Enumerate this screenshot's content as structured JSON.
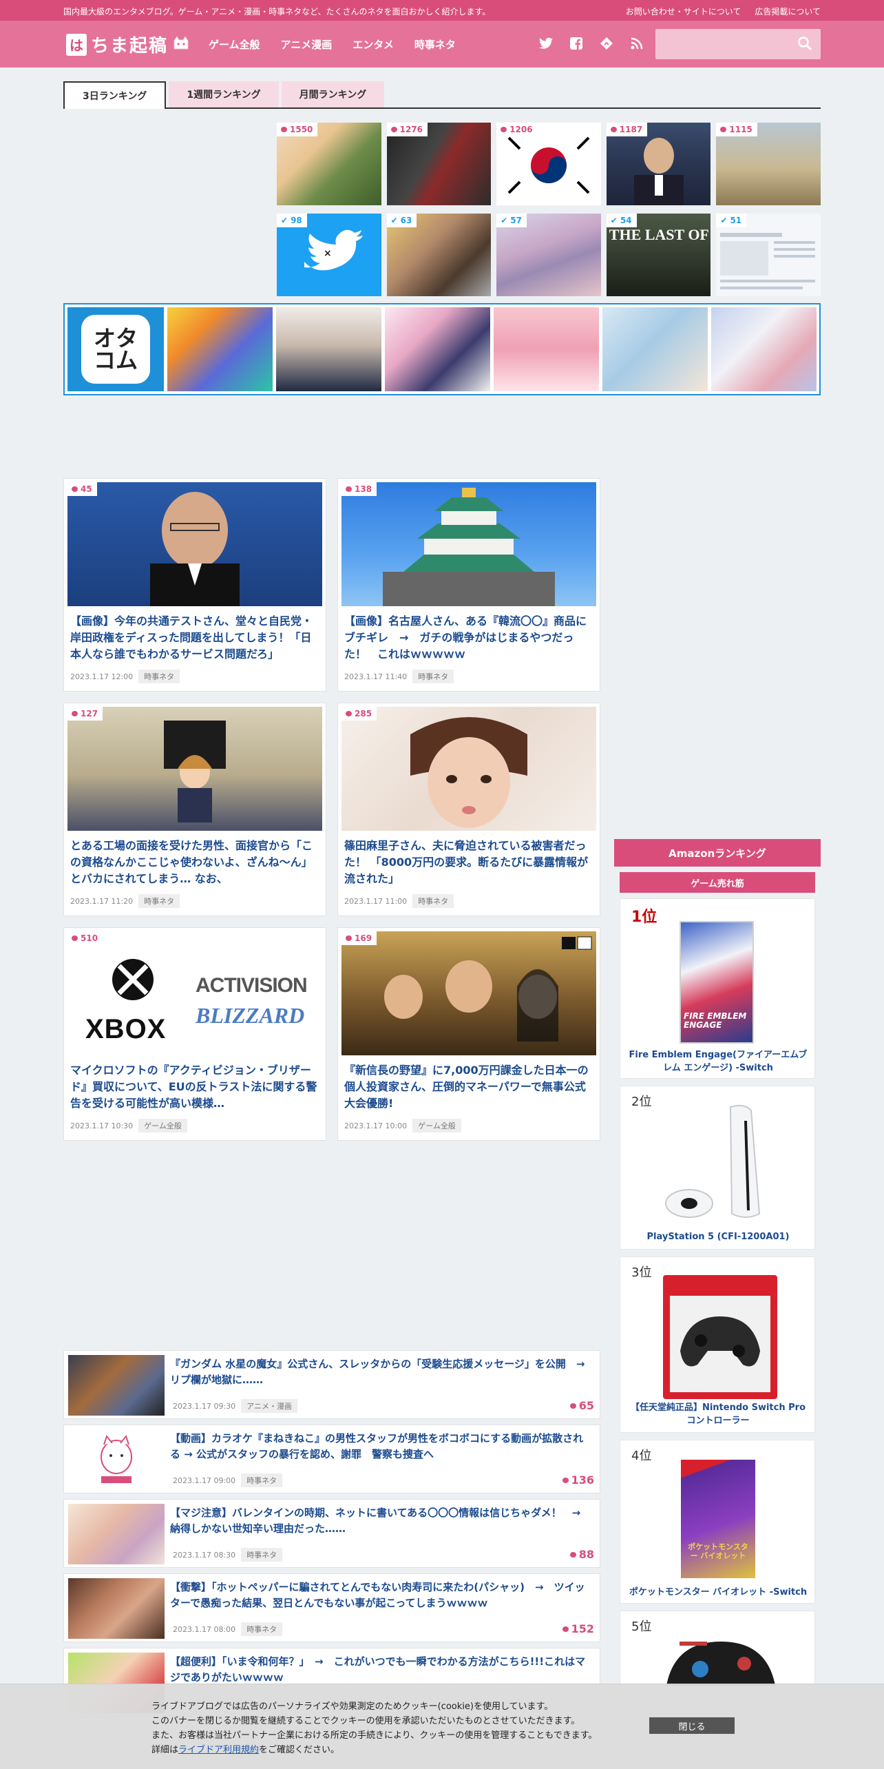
{
  "topbar": {
    "tagline": "国内最大級のエンタメブログ。ゲーム・アニメ・漫画・時事ネタなど、たくさんのネタを面白おかしく紹介します。",
    "links": [
      "お問い合わせ・サイトについて",
      "広告掲載について"
    ]
  },
  "header": {
    "logo_mark": "は",
    "logo_text": "ちま起稿",
    "nav": [
      "ゲーム全般",
      "アニメ漫画",
      "エンタメ",
      "時事ネタ"
    ],
    "social_icons": [
      "twitter-icon",
      "facebook-icon",
      "feedly-icon",
      "rss-icon"
    ],
    "search_placeholder": ""
  },
  "ranking": {
    "tabs": [
      "3日ランキング",
      "1週間ランキング",
      "月間ランキング"
    ],
    "active_tab": "3日ランキング",
    "row1_counts": [
      "1550",
      "1276",
      "1206",
      "1187",
      "1115"
    ],
    "row2_counts": [
      "98",
      "63",
      "57",
      "54",
      "51"
    ],
    "row2_overlay_text": [
      "",
      "",
      "",
      "THE LAST OF U",
      ""
    ]
  },
  "banner": {
    "logo_line1": "オタ",
    "logo_line2": "コム"
  },
  "cards": [
    {
      "count": "45",
      "title": "【画像】今年の共通テストさん、堂々と自民党・岸田政権をディスった問題を出してしまう！「日本人なら誰でもわかるサービス問題だろ」",
      "date": "2023.1.17 12:00",
      "category": "時事ネタ"
    },
    {
      "count": "138",
      "title": "【画像】名古屋人さん、ある『韓流〇〇』商品にブチギレ　→　ガチの戦争がはじまるやつだった！　これはｗｗｗｗｗ",
      "date": "2023.1.17 11:40",
      "category": "時事ネタ"
    },
    {
      "count": "127",
      "title": "とある工場の面接を受けた男性、面接官から「この資格なんかここじゃ使わないよ、ざんね～ん」とバカにされてしまう… なお、",
      "date": "2023.1.17 11:20",
      "category": "時事ネタ"
    },
    {
      "count": "285",
      "title": "篠田麻里子さん、夫に脅迫されている被害者だった！ 「8000万円の要求。断るたびに暴露情報が流された」",
      "date": "2023.1.17 11:00",
      "category": "時事ネタ"
    },
    {
      "count": "510",
      "title": "マイクロソフトの『アクティビジョン・ブリザード』買収について、EUの反トラスト法に関する警告を受ける可能性が高い模様…",
      "date": "2023.1.17 10:30",
      "category": "ゲーム全般",
      "image_text_1": "XBOX",
      "image_text_2": "ACTIVISION",
      "image_text_3": "BLIZZARD"
    },
    {
      "count": "169",
      "title": "『新信長の野望』に7,000万円課金した日本一の個人投資家さん、圧倒的マネーパワーで無事公式大会優勝!",
      "date": "2023.1.17 10:00",
      "category": "ゲーム全般"
    }
  ],
  "list": [
    {
      "title": "『ガンダム 水星の魔女』公式さん、スレッタからの「受験生応援メッセージ」を公開　→　リプ欄が地獄に……",
      "date": "2023.1.17 09:30",
      "category": "アニメ・漫画",
      "count": "65"
    },
    {
      "title": "【動画】カラオケ『まねきねこ』の男性スタッフが男性をボコボコにする動画が拡散される → 公式がスタッフの暴行を認め、謝罪　警察も捜査へ",
      "date": "2023.1.17 09:00",
      "category": "時事ネタ",
      "count": "136"
    },
    {
      "title": "【マジ注意】バレンタインの時期、ネットに書いてある〇〇〇情報は信じちゃダメ！　→　納得しかない世知辛い理由だった……",
      "date": "2023.1.17 08:30",
      "category": "時事ネタ",
      "count": "88"
    },
    {
      "title": "【衝撃】「ホットペッパーに騙されてとんでもない肉寿司に来たわ(パシャッ)　→　ツイッターで愚痴った結果、翌日とんでもない事が起こってしまうｗｗｗｗ",
      "date": "2023.1.17 08:00",
      "category": "時事ネタ",
      "count": "152"
    },
    {
      "title": "【超便利】「いま令和何年？」　→　これがいつでも一瞬でわかる方法がこちら!!!これはマジでありがたいｗｗｗｗ",
      "date": "",
      "category": "",
      "count": ""
    }
  ],
  "sidebar": {
    "heading": "Amazonランキング",
    "subheading": "ゲーム売れ筋",
    "items": [
      {
        "rank": "1位",
        "name": "Fire Emblem Engage(ファイアーエムブレム エンゲージ) -Switch",
        "box_text": "FIRE EMBLEM ENGAGE"
      },
      {
        "rank": "2位",
        "name": "PlayStation 5 (CFI-1200A01)"
      },
      {
        "rank": "3位",
        "name": "【任天堂純正品】Nintendo Switch Proコントローラー"
      },
      {
        "rank": "4位",
        "name": "ポケットモンスター バイオレット -Switch",
        "box_text": "ポケットモンスター バイオレット"
      },
      {
        "rank": "5位",
        "name": ""
      }
    ]
  },
  "cookie": {
    "line1": "ライブドアブログでは広告のパーソナライズや効果測定のためクッキー(cookie)を使用しています。",
    "line2": "このバナーを閉じるか閲覧を継続することでクッキーの使用を承認いただいたものとさせていただきます。",
    "line3": "また、お客様は当社パートナー企業における所定の手続きにより、クッキーの使用を管理することもできます。",
    "line4_prefix": "詳細は",
    "line4_link": "ライブドア利用規約",
    "line4_suffix": "をご確認ください。",
    "close_label": "閉じる"
  },
  "colors": {
    "brand_pink": "#d94d7a",
    "header_pink": "#e57298",
    "link_blue": "#1c4b8f",
    "twitter_blue": "#1da1f2",
    "otacom_blue": "#1e90d8"
  }
}
